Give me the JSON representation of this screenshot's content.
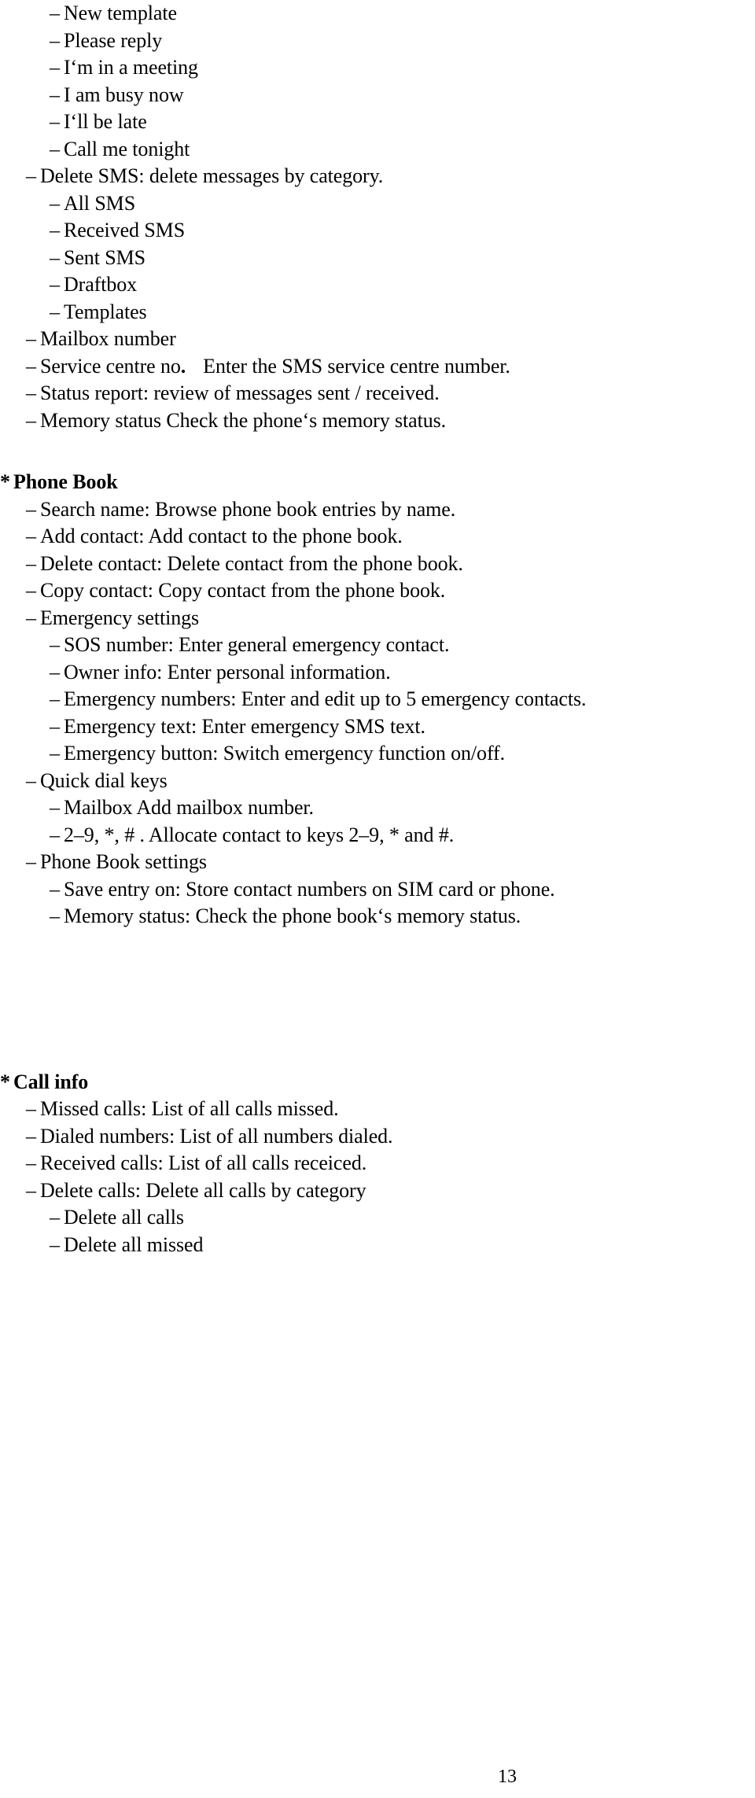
{
  "document": {
    "page_number": "13",
    "blocks": [
      {
        "type": "item",
        "level": 2,
        "bullet": "–",
        "text": "New template"
      },
      {
        "type": "item",
        "level": 2,
        "bullet": "–",
        "text": "Please reply"
      },
      {
        "type": "item",
        "level": 2,
        "bullet": "–",
        "text": "I‘m in a meeting"
      },
      {
        "type": "item",
        "level": 2,
        "bullet": "–",
        "text": "I am busy now"
      },
      {
        "type": "item",
        "level": 2,
        "bullet": "–",
        "text": "I‘ll be late"
      },
      {
        "type": "item",
        "level": 2,
        "bullet": "–",
        "text": "Call me tonight"
      },
      {
        "type": "item",
        "level": 1,
        "bullet": "–",
        "text": "Delete SMS: delete messages by category."
      },
      {
        "type": "item",
        "level": 2,
        "bullet": "–",
        "text": "All SMS"
      },
      {
        "type": "item",
        "level": 2,
        "bullet": "–",
        "text": "Received SMS"
      },
      {
        "type": "item",
        "level": 2,
        "bullet": "–",
        "text": "Sent SMS"
      },
      {
        "type": "item",
        "level": 2,
        "bullet": "–",
        "text": "Draftbox"
      },
      {
        "type": "item",
        "level": 2,
        "bullet": "–",
        "text": "Templates"
      },
      {
        "type": "item",
        "level": 1,
        "bullet": "–",
        "text": "Mailbox number"
      },
      {
        "type": "item-split",
        "level": 1,
        "bullet": "–",
        "text": "Service centre no",
        "bold_part": ".",
        "text_after": "Enter the SMS service centre number."
      },
      {
        "type": "item",
        "level": 1,
        "bullet": "–",
        "text": "Status report: review of messages sent / received."
      },
      {
        "type": "item",
        "level": 1,
        "bullet": "–",
        "text": "Memory status Check the phone‘s memory status."
      },
      {
        "type": "spacer",
        "size": "md"
      },
      {
        "type": "heading",
        "level": 0,
        "bullet": "*",
        "text": "Phone Book"
      },
      {
        "type": "item",
        "level": 1,
        "bullet": "–",
        "text": "Search name: Browse phone book entries by name."
      },
      {
        "type": "item",
        "level": 1,
        "bullet": "–",
        "text": "Add contact: Add contact to the phone book."
      },
      {
        "type": "item",
        "level": 1,
        "bullet": "–",
        "text": "Delete contact: Delete contact from the phone book."
      },
      {
        "type": "item",
        "level": 1,
        "bullet": "–",
        "text": "Copy contact: Copy contact from the phone book."
      },
      {
        "type": "item",
        "level": 1,
        "bullet": "–",
        "text": "Emergency settings"
      },
      {
        "type": "item",
        "level": 2,
        "bullet": "–",
        "text": "SOS number: Enter general emergency contact."
      },
      {
        "type": "item",
        "level": 2,
        "bullet": "–",
        "text": "Owner info: Enter personal information."
      },
      {
        "type": "item",
        "level": 2,
        "bullet": "–",
        "text": "Emergency numbers: Enter and edit up to 5 emergency contacts."
      },
      {
        "type": "item",
        "level": 2,
        "bullet": "–",
        "text": "Emergency text: Enter emergency SMS text."
      },
      {
        "type": "item",
        "level": 2,
        "bullet": "–",
        "text": "Emergency button: Switch emergency function on/off."
      },
      {
        "type": "item",
        "level": 1,
        "bullet": "–",
        "text": "Quick dial keys"
      },
      {
        "type": "item",
        "level": 2,
        "bullet": "–",
        "text": "Mailbox Add mailbox number."
      },
      {
        "type": "item",
        "level": 2,
        "bullet": "–",
        "text": "2–9, *, # . Allocate contact to keys 2–9, * and #."
      },
      {
        "type": "item",
        "level": 1,
        "bullet": "–",
        "text": "Phone Book settings"
      },
      {
        "type": "item",
        "level": 2,
        "bullet": "–",
        "text": "Save entry on: Store contact numbers on SIM card or phone."
      },
      {
        "type": "item",
        "level": 2,
        "bullet": "–",
        "text": "Memory status: Check the phone book‘s memory status."
      },
      {
        "type": "spacer",
        "size": "xl"
      },
      {
        "type": "heading",
        "level": 0,
        "bullet": "*",
        "text": "Call info"
      },
      {
        "type": "item",
        "level": 1,
        "bullet": "–",
        "text": "Missed calls: List of all calls missed."
      },
      {
        "type": "item",
        "level": 1,
        "bullet": "–",
        "text": "Dialed numbers: List of all numbers dialed."
      },
      {
        "type": "item",
        "level": 1,
        "bullet": "–",
        "text": "Received calls: List of all calls receiced."
      },
      {
        "type": "item",
        "level": 1,
        "bullet": "–",
        "text": "Delete calls: Delete all calls by category"
      },
      {
        "type": "item",
        "level": 2,
        "bullet": "–",
        "text": "Delete all calls"
      },
      {
        "type": "item",
        "level": 2,
        "bullet": "–",
        "text": "Delete all missed"
      }
    ]
  }
}
